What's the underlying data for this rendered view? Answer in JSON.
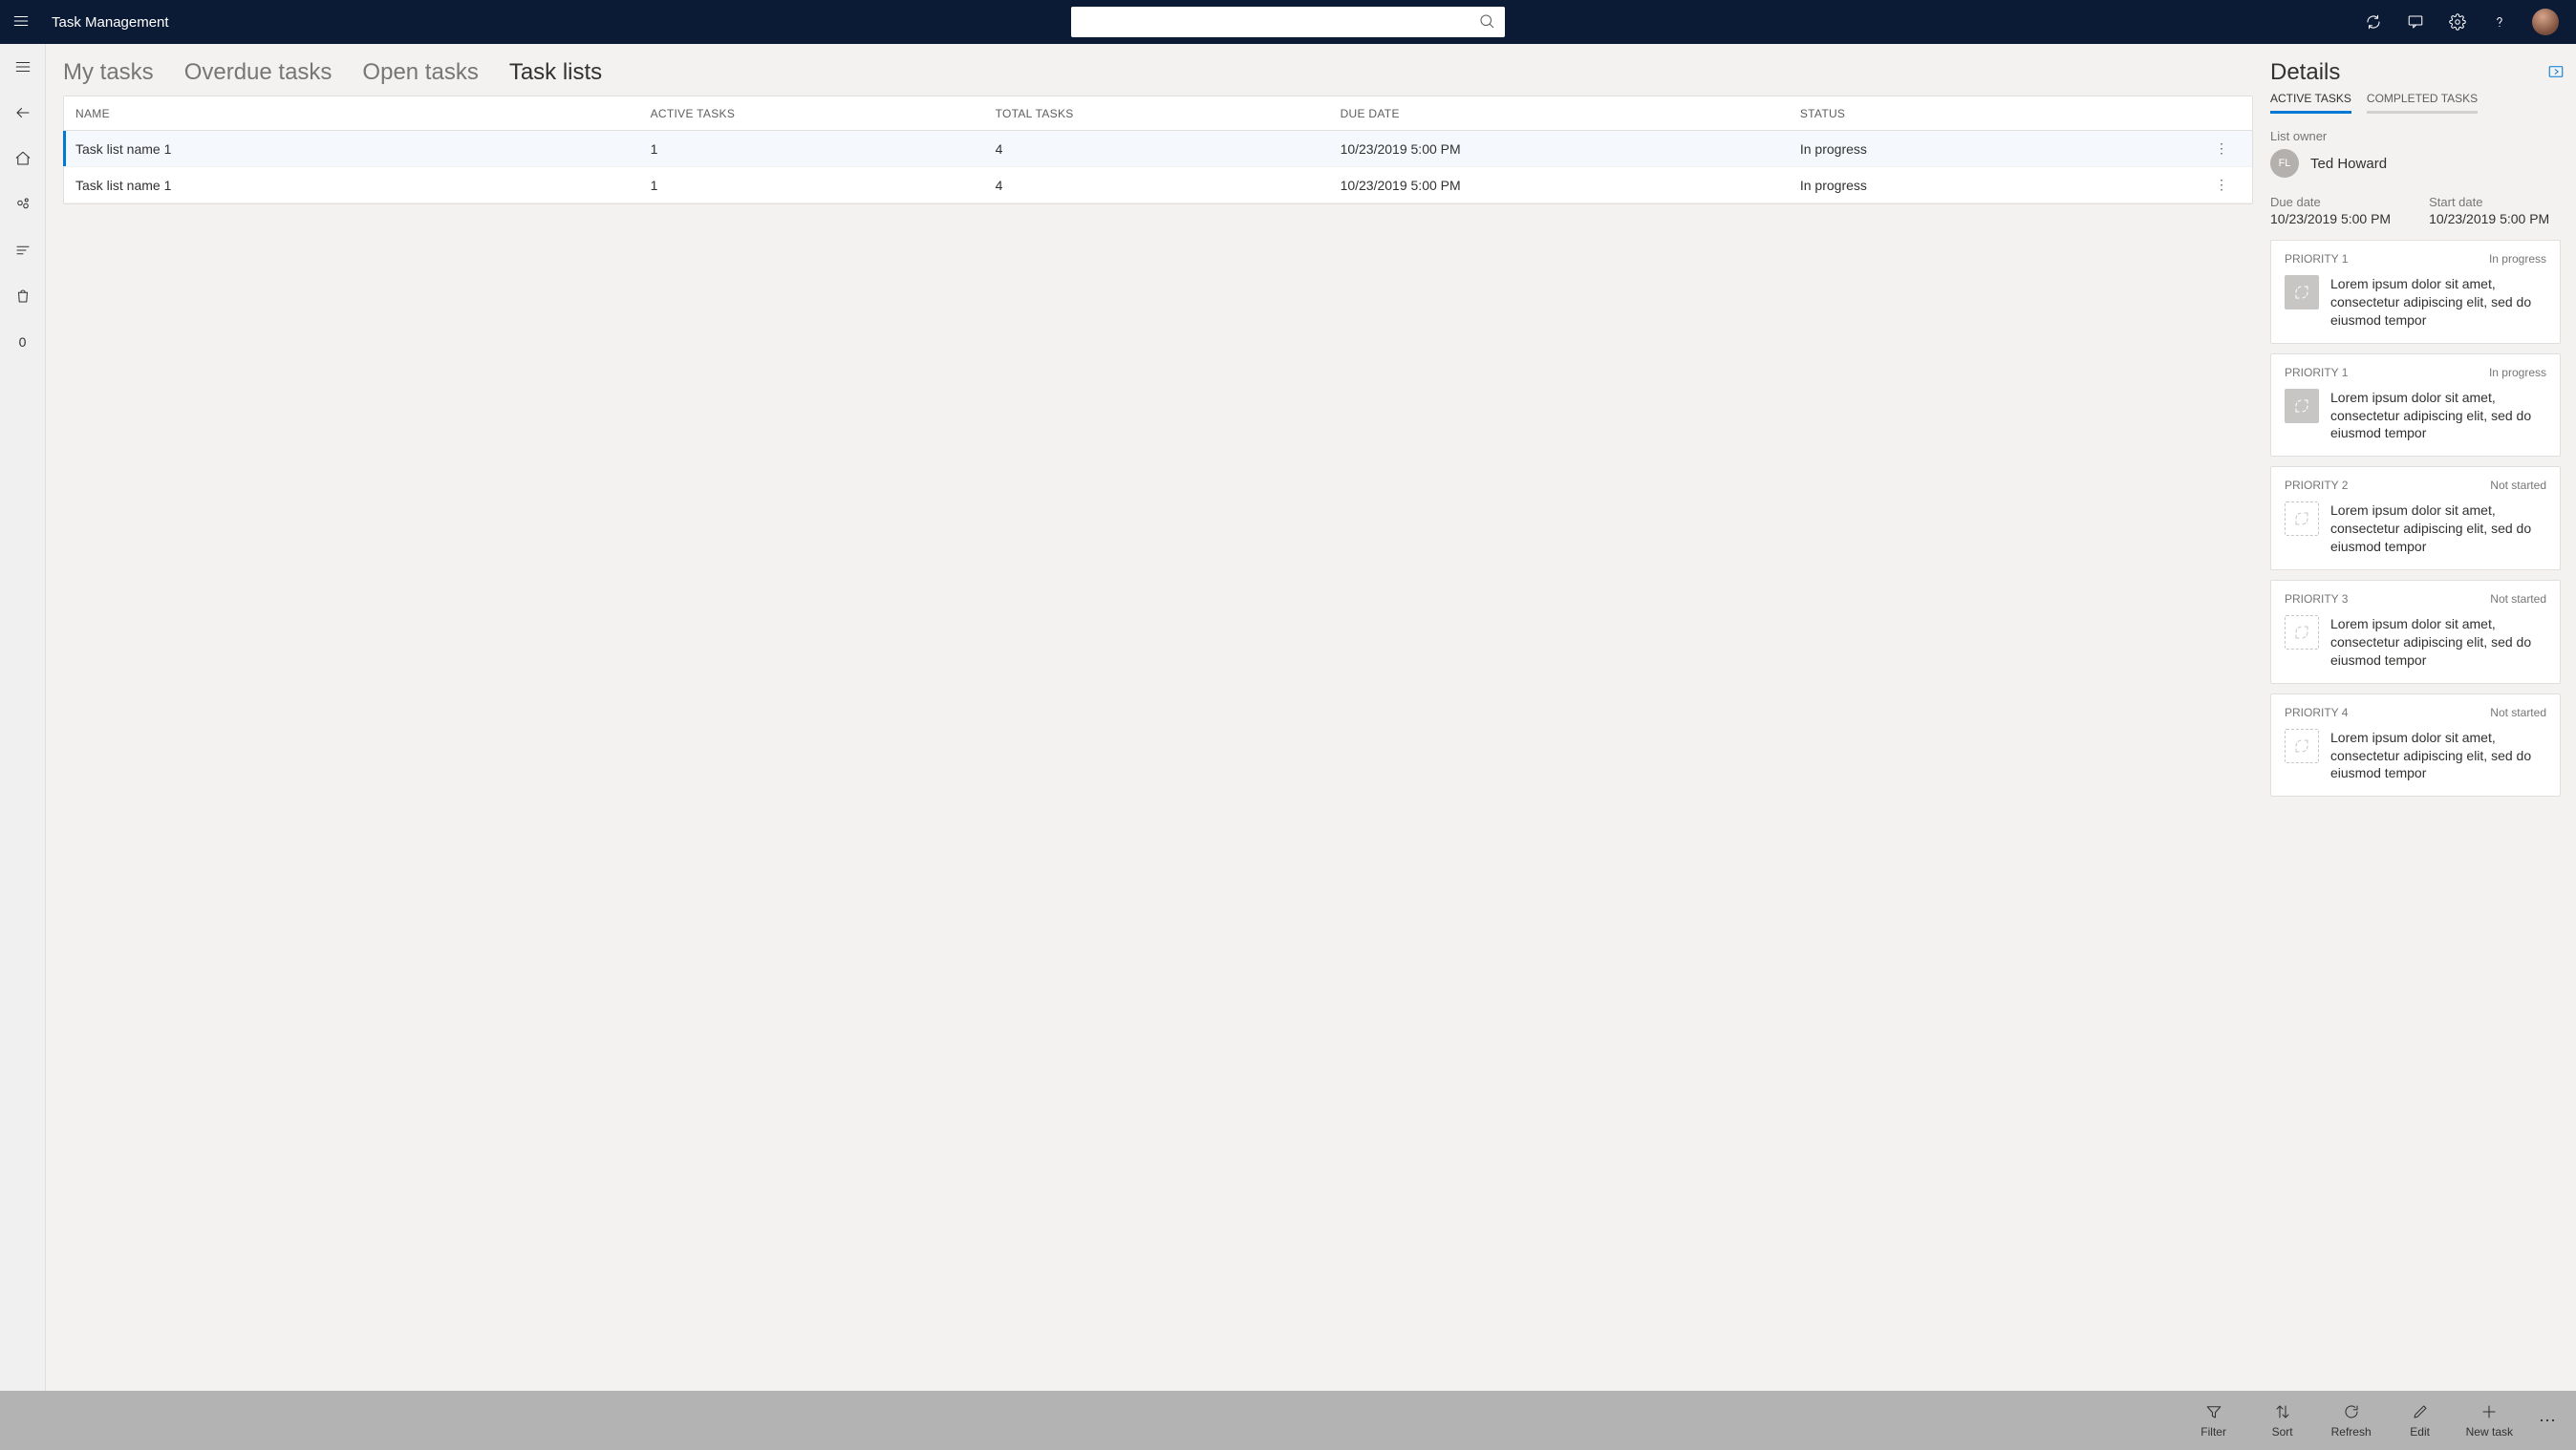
{
  "app_title": "Task Management",
  "search": {
    "placeholder": ""
  },
  "tabs": [
    {
      "label": "My tasks",
      "active": false
    },
    {
      "label": "Overdue tasks",
      "active": false
    },
    {
      "label": "Open tasks",
      "active": false
    },
    {
      "label": "Task lists",
      "active": true
    }
  ],
  "columns": {
    "name": "NAME",
    "active_tasks": "ACTIVE TASKS",
    "total_tasks": "TOTAL TASKS",
    "due_date": "DUE DATE",
    "status": "STATUS"
  },
  "rows": [
    {
      "name": "Task list name 1",
      "active": "1",
      "total": "4",
      "due": "10/23/2019 5:00 PM",
      "status": "In progress",
      "selected": true
    },
    {
      "name": "Task list name 1",
      "active": "1",
      "total": "4",
      "due": "10/23/2019 5:00 PM",
      "status": "In progress",
      "selected": false
    }
  ],
  "details": {
    "title": "Details",
    "tabs": {
      "active": "ACTIVE TASKS",
      "completed": "COMPLETED TASKS"
    },
    "owner_label": "List owner",
    "owner_initials": "FL",
    "owner_name": "Ted Howard",
    "due_label": "Due date",
    "due_value": "10/23/2019 5:00 PM",
    "start_label": "Start date",
    "start_value": "10/23/2019 5:00 PM",
    "cards": [
      {
        "priority": "PRIORITY 1",
        "status": "In progress",
        "desc": "Lorem ipsum dolor sit amet, consectetur adipiscing elit, sed do eiusmod tempor",
        "filled": true
      },
      {
        "priority": "PRIORITY 1",
        "status": "In progress",
        "desc": "Lorem ipsum dolor sit amet, consectetur adipiscing elit, sed do eiusmod tempor",
        "filled": true
      },
      {
        "priority": "PRIORITY 2",
        "status": "Not started",
        "desc": "Lorem ipsum dolor sit amet, consectetur adipiscing elit, sed do eiusmod tempor",
        "filled": false
      },
      {
        "priority": "PRIORITY 3",
        "status": "Not started",
        "desc": "Lorem ipsum dolor sit amet, consectetur adipiscing elit, sed do eiusmod tempor",
        "filled": false
      },
      {
        "priority": "PRIORITY 4",
        "status": "Not started",
        "desc": "Lorem ipsum dolor sit amet, consectetur adipiscing elit, sed do eiusmod tempor",
        "filled": false
      }
    ]
  },
  "cmdbar": {
    "filter": "Filter",
    "sort": "Sort",
    "refresh": "Refresh",
    "edit": "Edit",
    "new_task": "New task"
  },
  "leftnav_count": "0"
}
